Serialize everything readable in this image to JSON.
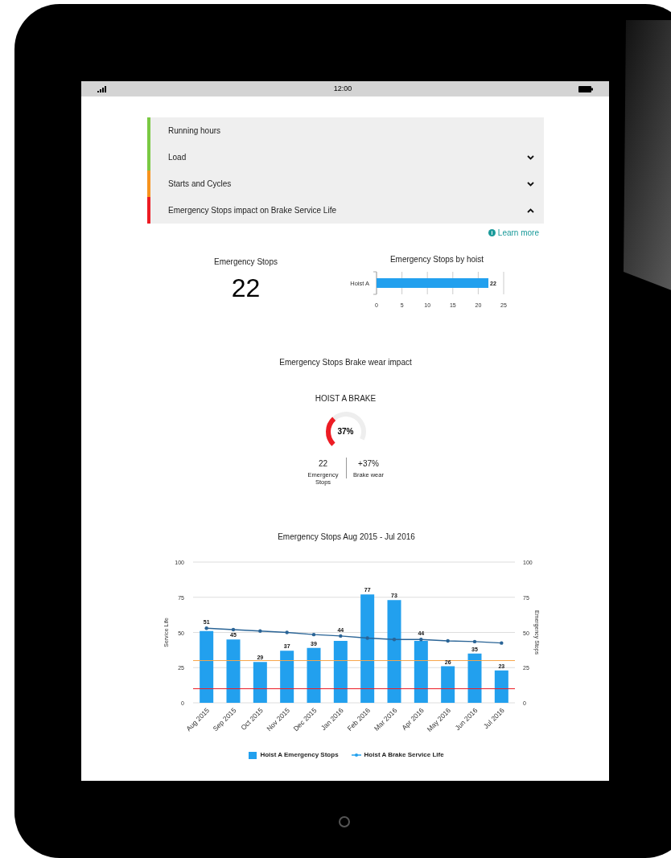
{
  "status_bar": {
    "time": "12:00"
  },
  "accordion": [
    {
      "label": "Running hours",
      "color": "#7ac943",
      "kind": "static"
    },
    {
      "label": "Load",
      "color": "#7ac943",
      "kind": "expandable",
      "expanded": false
    },
    {
      "label": "Starts and Cycles",
      "color": "#f7931e",
      "kind": "expandable",
      "expanded": false
    },
    {
      "label": "Emergency Stops impact on Brake Service Life",
      "color": "#ed1c24",
      "kind": "expandable",
      "expanded": true
    }
  ],
  "learn_more": {
    "icon": "i",
    "label": "Learn more"
  },
  "stat": {
    "title": "Emergency Stops",
    "value": "22"
  },
  "hoist_chart": {
    "chart_data": {
      "type": "bar",
      "orientation": "horizontal",
      "title": "Emergency Stops by hoist",
      "categories": [
        "Hoist A"
      ],
      "values": [
        22
      ],
      "xlim": [
        0,
        25
      ],
      "xticks": [
        0,
        5,
        10,
        15,
        20,
        25
      ],
      "grid": true,
      "data_labels": true
    }
  },
  "wear_section": {
    "title": "Emergency Stops Brake wear impact",
    "gauge_title": "HOIST A BRAKE",
    "gauge_value": "37%",
    "stats": [
      {
        "value": "22",
        "label": "Emergency Stops"
      },
      {
        "value": "+37%",
        "label": "Brake wear"
      }
    ]
  },
  "monthly_chart": {
    "right_axis": {
      "title": "Emergency Stops",
      "ticks": [
        "100",
        "75",
        "50",
        "25",
        "0"
      ]
    },
    "chart_data": {
      "type": "bar",
      "title": "Emergency Stops Aug 2015 - Jul 2016",
      "ylabel": "Service Life",
      "categories": [
        "Aug 2015",
        "Sep 2015",
        "Oct 2015",
        "Nov 2015",
        "Dec 2015",
        "Jan 2016",
        "Feb 2016",
        "Mar 2016",
        "Apr 2016",
        "May 2016",
        "Jun 2016",
        "Jul 2016"
      ],
      "series": [
        {
          "name": "Hoist A Emergency Stops",
          "type": "bar",
          "color": "#22a0ee",
          "values": [
            51,
            45,
            29,
            37,
            39,
            44,
            77,
            73,
            44,
            26,
            35,
            23
          ]
        },
        {
          "name": "Hoist A Brake Service Life",
          "type": "line",
          "color": "#2a6496",
          "values": [
            53,
            52,
            51,
            50,
            48.5,
            47.5,
            46,
            45,
            45,
            44,
            43.5,
            42.5
          ]
        }
      ],
      "ylim": [
        0,
        100
      ],
      "yticks": [
        0,
        25,
        50,
        75,
        100
      ],
      "grid": true,
      "value_labels": [
        [
          "51",
          "45",
          "29",
          "37",
          "39",
          "44",
          "77",
          "73",
          "44",
          "26",
          "35",
          "23"
        ],
        [
          null,
          null,
          null,
          null,
          null,
          null,
          null,
          null,
          null,
          null,
          null,
          null
        ]
      ],
      "ref_lines": [
        {
          "axis": "y",
          "value": 30,
          "color": "#f7a64a"
        },
        {
          "axis": "y",
          "value": 10,
          "color": "#ed1c24"
        }
      ]
    }
  }
}
